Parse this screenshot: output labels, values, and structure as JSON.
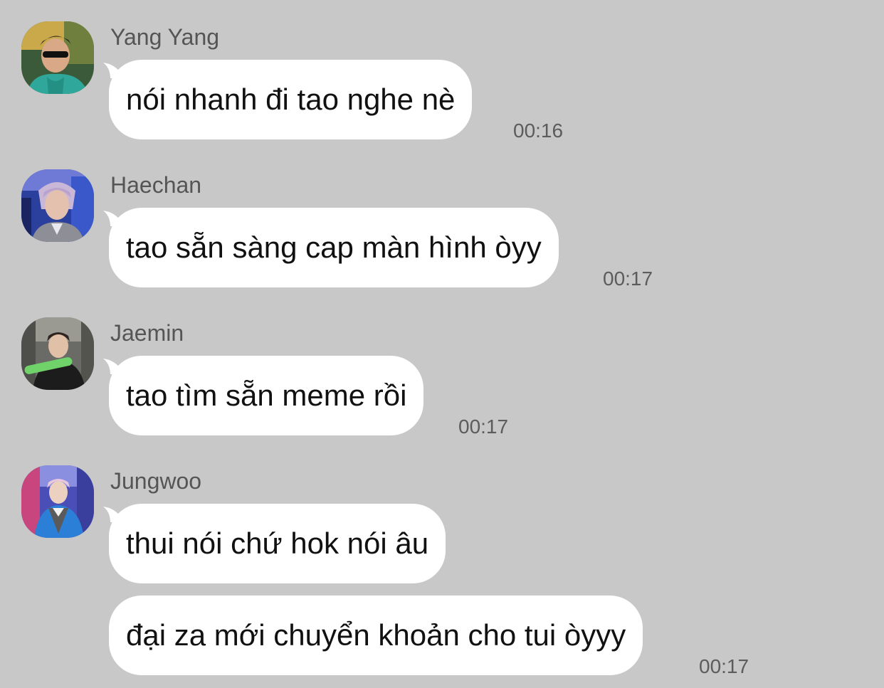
{
  "messages": [
    {
      "sender": "Yang Yang",
      "avatar_icon": "profile-photo",
      "texts": [
        "nói nhanh đi tao nghe nè"
      ],
      "time": "00:16"
    },
    {
      "sender": "Haechan",
      "avatar_icon": "profile-photo",
      "texts": [
        "tao sẵn sàng cap màn hình òyy"
      ],
      "time": "00:17"
    },
    {
      "sender": "Jaemin",
      "avatar_icon": "profile-photo",
      "texts": [
        "tao tìm sẵn meme rồi"
      ],
      "time": "00:17"
    },
    {
      "sender": "Jungwoo",
      "avatar_icon": "profile-photo",
      "texts": [
        "thui nói chứ hok nói âu",
        "đại za mới chuyển khoản cho tui òyyy"
      ],
      "time": "00:17"
    }
  ],
  "colors": {
    "background": "#c8c8c8",
    "bubble": "#ffffff",
    "sender_text": "#555555",
    "timestamp": "#5c5c5c"
  }
}
